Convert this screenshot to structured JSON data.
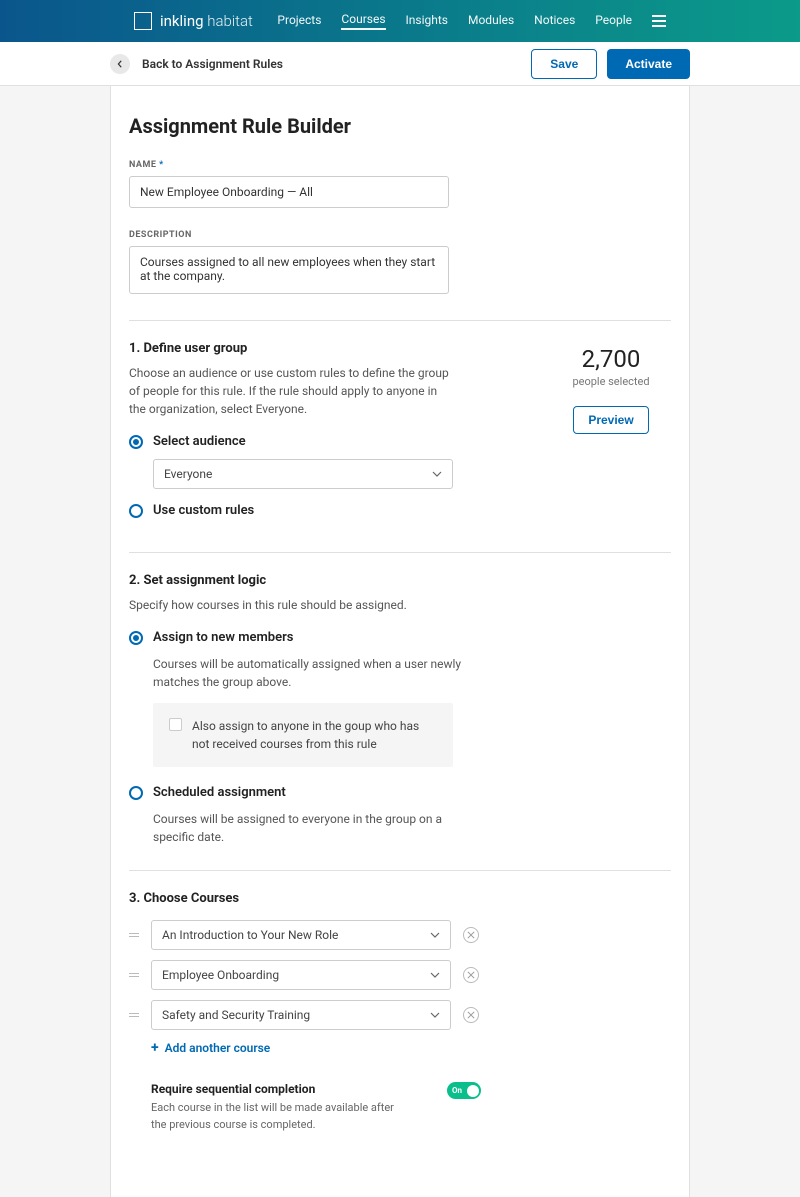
{
  "brand": {
    "name1": "inkling",
    "name2": " habitat"
  },
  "nav": {
    "projects": "Projects",
    "courses": "Courses",
    "insights": "Insights",
    "modules": "Modules",
    "notices": "Notices",
    "people": "People"
  },
  "subheader": {
    "back": "Back to Assignment Rules",
    "save": "Save",
    "activate": "Activate"
  },
  "page_title": "Assignment Rule Builder",
  "name_field": {
    "label": "Name",
    "req": " *",
    "value": "New Employee Onboarding — All"
  },
  "desc_field": {
    "label": "Description",
    "value": "Courses assigned to all new employees when they start at the company."
  },
  "section1": {
    "title": "1. Define user group",
    "desc": "Choose an audience or use custom rules to define the group of people for this rule. If the rule should apply to anyone in the organization, select Everyone.",
    "count": "2,700",
    "count_label": "people selected",
    "preview": "Preview",
    "opt_audience": "Select audience",
    "audience_value": "Everyone",
    "opt_custom": "Use custom rules"
  },
  "section2": {
    "title": "2. Set assignment logic",
    "desc": "Specify how courses in this rule should be assigned.",
    "opt_new": "Assign to new members",
    "opt_new_desc": "Courses will be automatically assigned when a user newly matches the group above.",
    "check_text": "Also assign to anyone in the goup who has not received courses from this rule",
    "opt_sched": "Scheduled assignment",
    "opt_sched_desc": "Courses will be assigned to everyone in the group on a specific date."
  },
  "section3": {
    "title": "3. Choose Courses",
    "courses": [
      "An Introduction to Your New Role",
      "Employee Onboarding",
      "Safety and Security Training"
    ],
    "add": "Add another course",
    "seq_title": "Require sequential completion",
    "seq_desc": "Each course in the list will be made available after the previous course is completed.",
    "toggle_label": "On"
  }
}
